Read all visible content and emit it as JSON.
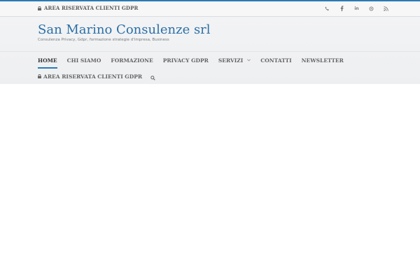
{
  "topbar": {
    "reserved_area_label": "Area riservata clienti GDPR",
    "social_icons": [
      "phone-icon",
      "facebook-icon",
      "linkedin-icon",
      "email-icon",
      "rss-icon"
    ]
  },
  "site": {
    "title": "San Marino Consulenze srl",
    "tagline": "Consulenza Privacy, Gdpr, formazione strategie d'impresa, Business"
  },
  "nav": {
    "home": "Home",
    "chi_siamo": "Chi siamo",
    "formazione": "Formazione",
    "privacy_gdpr": "Privacy GDPR",
    "servizi": "Servizi",
    "contatti": "Contatti",
    "newsletter": "Newsletter",
    "reserved_area": "Area riservata clienti GDPR"
  },
  "colors": {
    "accent": "#2a7bb5",
    "title": "#2a6fa5"
  }
}
